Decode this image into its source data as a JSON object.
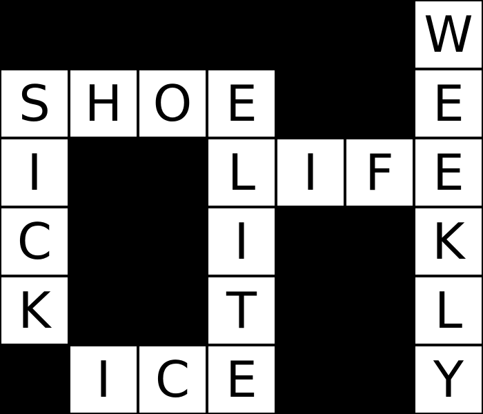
{
  "puzzle": {
    "rows": 6,
    "cols": 7,
    "grid": [
      [
        "#",
        "#",
        "#",
        "#",
        "#",
        "#",
        "W"
      ],
      [
        "S",
        "H",
        "O",
        "E",
        "#",
        "#",
        "E"
      ],
      [
        "I",
        "#",
        "#",
        "L",
        "I",
        "F",
        "E"
      ],
      [
        "C",
        "#",
        "#",
        "I",
        "#",
        "#",
        "K"
      ],
      [
        "K",
        "#",
        "#",
        "T",
        "#",
        "#",
        "L"
      ],
      [
        "#",
        "I",
        "C",
        "E",
        "#",
        "#",
        "Y"
      ]
    ],
    "words": [
      "SHOE",
      "LIFE",
      "ICE",
      "SICK",
      "ELITE",
      "WEEKLY"
    ]
  },
  "colors": {
    "block": "#000000",
    "cell": "#ffffff",
    "letter": "#000000"
  }
}
